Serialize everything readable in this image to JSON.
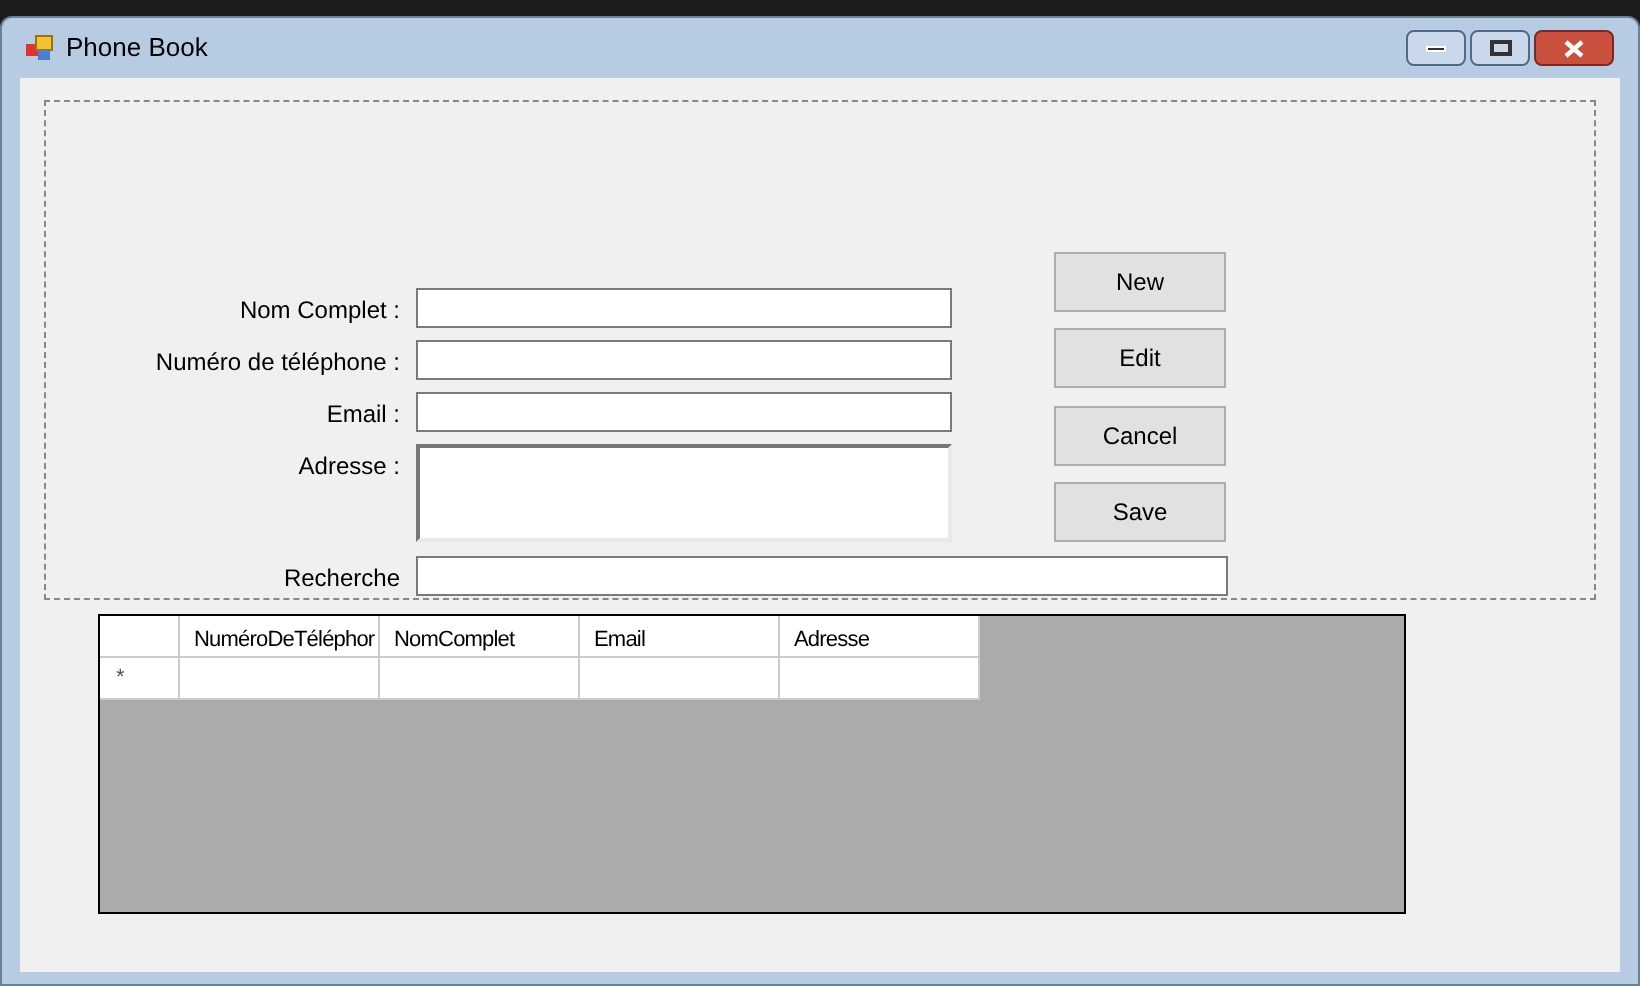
{
  "window": {
    "title": "Phone Book"
  },
  "form": {
    "fields": [
      {
        "label": "Nom Complet :",
        "kind": "text"
      },
      {
        "label": "Numéro de téléphone :",
        "kind": "text"
      },
      {
        "label": "Email :",
        "kind": "text"
      },
      {
        "label": "Adresse :",
        "kind": "multiline"
      }
    ],
    "buttons": [
      "New",
      "Edit",
      "Cancel",
      "Save"
    ],
    "search": {
      "label": "Recherche"
    }
  },
  "table": {
    "columns": [
      "NuméroDeTéléphor",
      "NomComplet",
      "Email",
      "Adresse"
    ],
    "new_row_marker": "*"
  }
}
